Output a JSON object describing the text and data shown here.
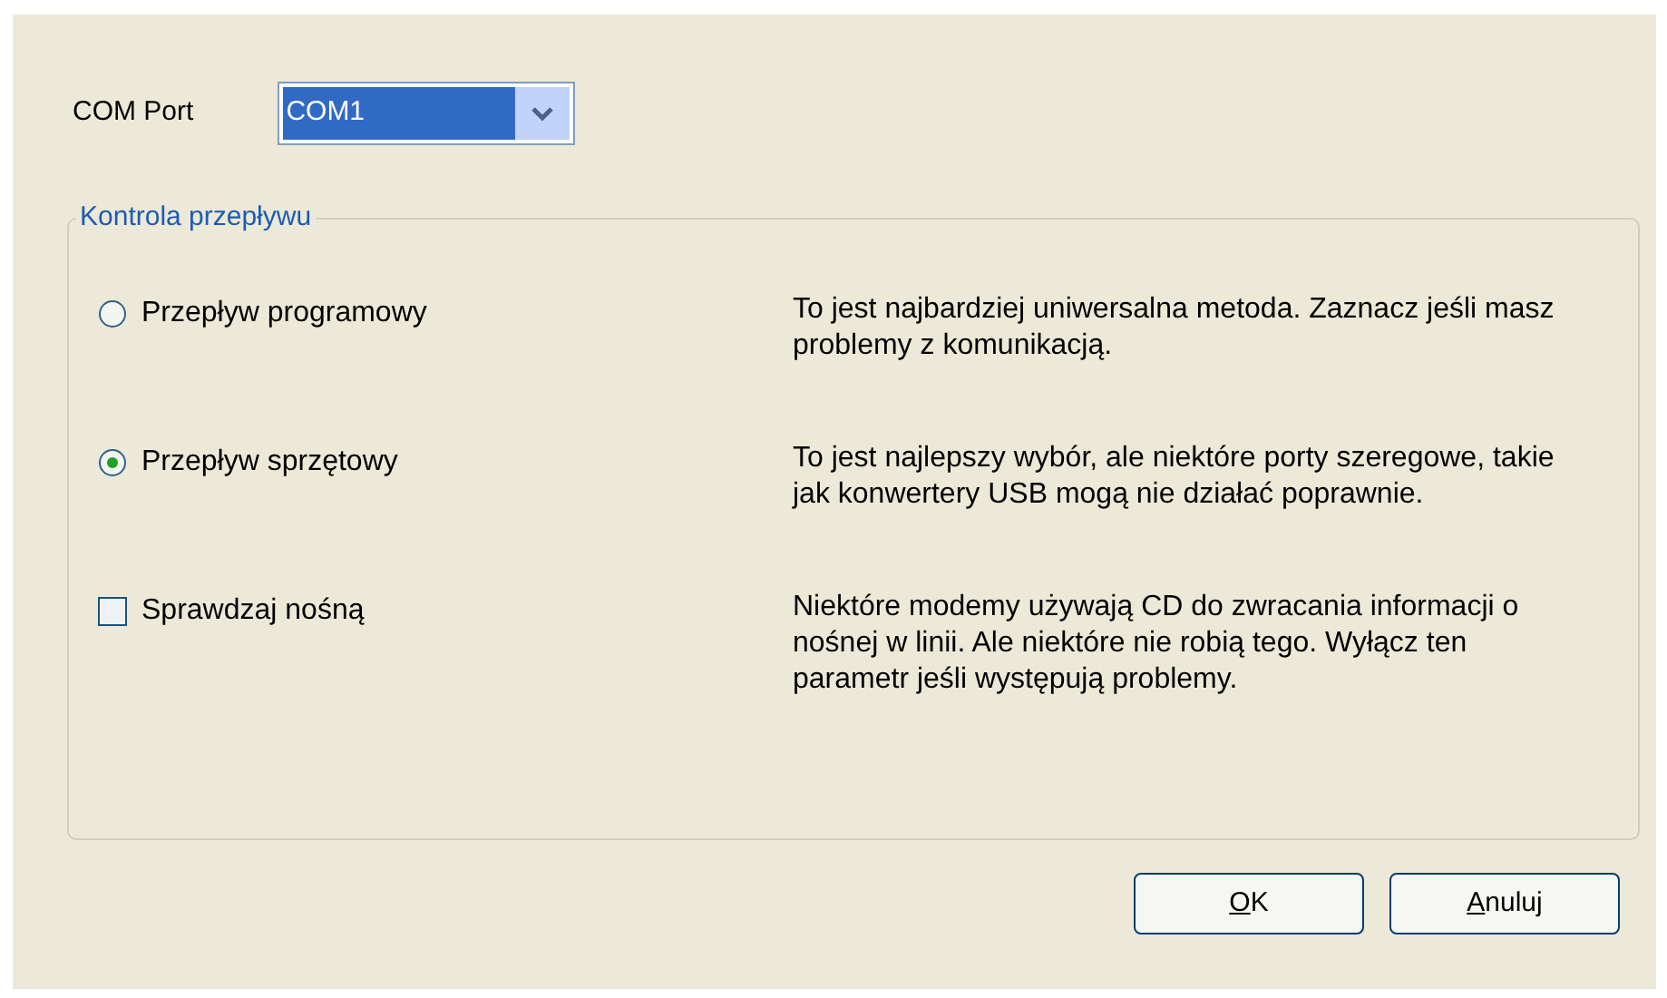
{
  "com_port": {
    "label": "COM Port",
    "value": "COM1",
    "focused": true
  },
  "flow_control": {
    "title": "Kontrola przepływu",
    "options": [
      {
        "kind": "radio",
        "label": "Przepływ programowy",
        "selected": false,
        "description": "To jest najbardziej uniwersalna metoda. Zaznacz jeśli masz problemy z komunikacją."
      },
      {
        "kind": "radio",
        "label": "Przepływ sprzętowy",
        "selected": true,
        "description": "To jest najlepszy wybór, ale niektóre porty szeregowe, takie jak konwertery USB mogą nie działać poprawnie."
      },
      {
        "kind": "checkbox",
        "label": "Sprawdzaj nośną",
        "checked": false,
        "description": "Niektóre modemy używają CD do zwracania informacji o nośnej w linii. Ale niektóre nie robią tego. Wyłącz ten parametr jeśli występują problemy."
      }
    ]
  },
  "buttons": [
    {
      "label": "OK",
      "first_letter_underlined": true
    },
    {
      "label": "Anuluj",
      "first_letter_underlined": true
    }
  ]
}
